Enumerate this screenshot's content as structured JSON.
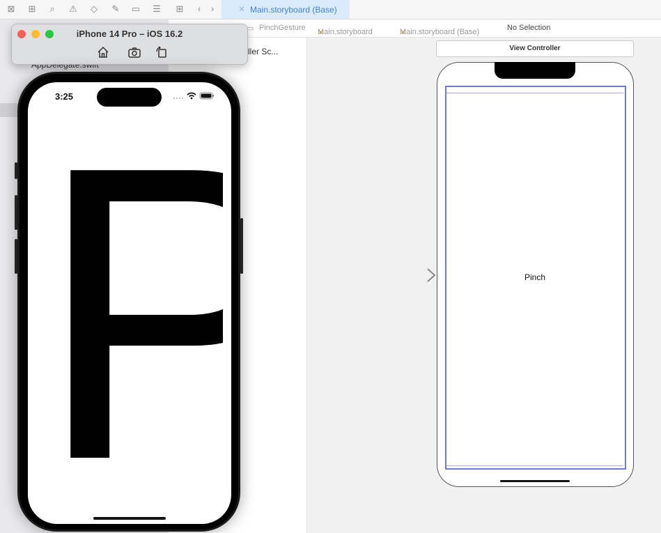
{
  "toolbar": {
    "tab_title": "Main.storyboard (Base)"
  },
  "breadcrumb": {
    "items": [
      "PinchGesture",
      "Main.storyboard",
      "Main.storyboard (Base)",
      "No Selection"
    ]
  },
  "navigator": {
    "file_label": "AppDelegate.swift"
  },
  "outline": {
    "scene_label": "ller Sc..."
  },
  "canvas": {
    "view_controller_title": "View Controller",
    "label_text": "Pinch"
  },
  "simulator": {
    "title": "iPhone 14 Pro – iOS 16.2",
    "status_time": "3:25",
    "display_text": "P",
    "buttons": [
      "home-icon",
      "screenshot-icon",
      "rotate-icon"
    ]
  },
  "colors": {
    "accent_blue": "#3f83d3",
    "safe_area": "#6e78e0",
    "traffic_red": "#fe5f57",
    "traffic_yellow": "#febc2e",
    "traffic_green": "#28c840"
  }
}
